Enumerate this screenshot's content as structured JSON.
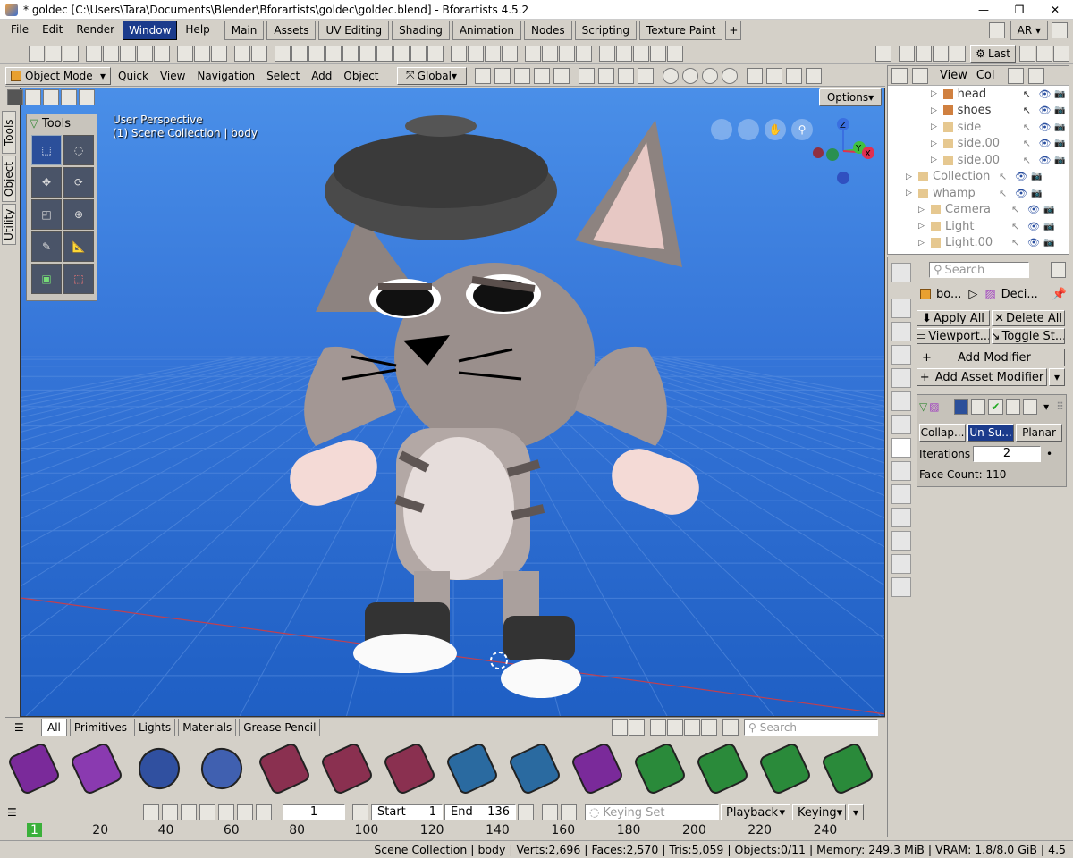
{
  "titlebar": {
    "title": "* goldec [C:\\Users\\Tara\\Documents\\Blender\\Bforartists\\goldec\\goldec.blend] - Bforartists 4.5.2",
    "min": "—",
    "max": "❐",
    "close": "✕"
  },
  "menubar": {
    "items": [
      "File",
      "Edit",
      "Render",
      "Window",
      "Help"
    ],
    "active": "Window",
    "workspaces": [
      "Main",
      "Assets",
      "UV Editing",
      "Shading",
      "Animation",
      "Nodes",
      "Scripting",
      "Texture Paint"
    ],
    "add_workspace": "+",
    "scene_label": "AR"
  },
  "toolbar2": {
    "last_label": "Last"
  },
  "viewport_header": {
    "mode": "Object Mode",
    "menus": [
      "Quick",
      "View",
      "Navigation",
      "Select",
      "Add",
      "Object"
    ],
    "transform_orientation": "Global"
  },
  "viewport": {
    "options_label": "Options",
    "perspective_label": "User Perspective",
    "collection_label": "(1) Scene Collection | body",
    "tools_panel_title": "Tools",
    "side_tabs": [
      "Tools",
      "Object",
      "Utility"
    ],
    "gizmo_axes": [
      "Z",
      "Y",
      "X"
    ],
    "bg_top": "#3c7ad9",
    "bg_bottom": "#1f5fc4"
  },
  "outliner": {
    "header_items": [
      "View",
      "Col"
    ],
    "rows": [
      {
        "label": "head",
        "indent": 3,
        "dim": false
      },
      {
        "label": "shoes",
        "indent": 3,
        "dim": false
      },
      {
        "label": "side",
        "indent": 3,
        "dim": true
      },
      {
        "label": "side.00",
        "indent": 3,
        "dim": true
      },
      {
        "label": "side.00",
        "indent": 3,
        "dim": true
      },
      {
        "label": "Collection",
        "indent": 1,
        "dim": true
      },
      {
        "label": "whamp",
        "indent": 1,
        "dim": true
      },
      {
        "label": "Camera",
        "indent": 2,
        "dim": true
      },
      {
        "label": "Light",
        "indent": 2,
        "dim": true
      },
      {
        "label": "Light.00",
        "indent": 2,
        "dim": true
      }
    ]
  },
  "properties": {
    "search_placeholder": "Search",
    "breadcrumb_object": "bo...",
    "breadcrumb_modifier": "Deci...",
    "apply_all": "Apply All",
    "delete_all": "Delete All",
    "viewport": "Viewport...",
    "toggle_stack": "Toggle St...",
    "add_modifier": "Add Modifier",
    "add_asset_modifier": "Add Asset Modifier",
    "modes": [
      "Collap...",
      "Un-Su...",
      "Planar"
    ],
    "active_mode": "Un-Su...",
    "iterations_label": "Iterations",
    "iterations_value": "2",
    "face_count": "Face Count: 110"
  },
  "asset_shelf": {
    "tabs": [
      "All",
      "Primitives",
      "Lights",
      "Materials",
      "Grease Pencil"
    ],
    "search_placeholder": "Search",
    "items": [
      "brush-icon",
      "brush-icon",
      "torus-icon",
      "torus-icon",
      "cone-icon",
      "cone-icon",
      "cone-icon",
      "cube-icon",
      "cube-icon",
      "brush-icon",
      "cylinder-icon",
      "cylinder-icon",
      "cylinder-icon",
      "cylinder-icon"
    ]
  },
  "timeline": {
    "current_frame": "1",
    "start_label": "Start",
    "start_value": "1",
    "end_label": "End",
    "end_value": "136",
    "keying_set": "Keying Set",
    "playback": "Playback",
    "keying": "Keying",
    "ticks": [
      "1",
      "20",
      "40",
      "60",
      "80",
      "100",
      "120",
      "140",
      "160",
      "180",
      "200",
      "220",
      "240"
    ]
  },
  "statusbar": {
    "text": "Scene Collection | body | Verts:2,696 | Faces:2,570 | Tris:5,059 | Objects:0/11 | Memory: 249.3 MiB | VRAM: 1.8/8.0 GiB | 4.5"
  }
}
